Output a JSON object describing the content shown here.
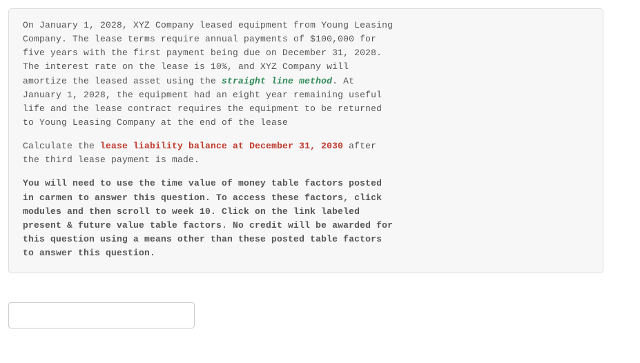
{
  "question": {
    "p1a": "On January 1, 2028, XYZ Company leased equipment from Young Leasing Company. The lease terms require annual payments of $100,000 for five years with the first payment being due on December 31, 2028. The interest rate on the lease is 10%, and XYZ Company will amortize the leased asset using the ",
    "p1_highlight": "straight line method",
    "p1b": ". At January 1, 2028, the equipment had an eight year remaining useful life and the lease contract requires the equipment to be returned to Young Leasing Company at the end of the lease",
    "p2a": "Calculate the ",
    "p2_highlight": "lease liability balance at December 31, 2030",
    "p2b": " after the third lease payment is made.",
    "p3": "You will need to use the time value of money table factors posted in carmen to answer this question. To access these factors, click modules and then scroll to week 10. Click on the link labeled present & future value table factors. No credit will be awarded for this question using a means other than these posted table factors to answer this question."
  },
  "answer": {
    "value": ""
  }
}
